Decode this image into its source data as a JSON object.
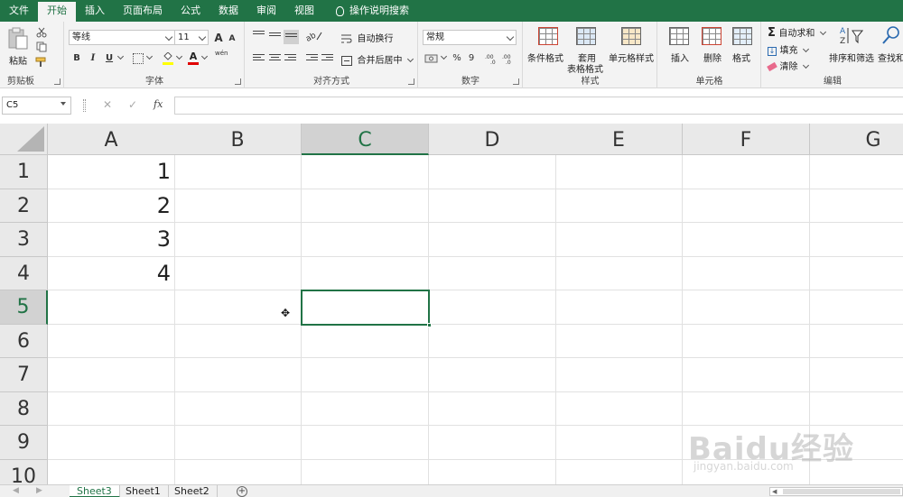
{
  "menu": {
    "tabs": [
      "文件",
      "开始",
      "插入",
      "页面布局",
      "公式",
      "数据",
      "审阅",
      "视图"
    ],
    "active_tab": "开始",
    "tell_me": "操作说明搜索"
  },
  "ribbon": {
    "clipboard": {
      "label": "剪贴板",
      "paste": "粘贴"
    },
    "font": {
      "label": "字体",
      "font_name": "等线",
      "font_size": "11",
      "grow": "A",
      "shrink": "A",
      "bold": "B",
      "italic": "I",
      "underline": "U",
      "wen": "wén"
    },
    "alignment": {
      "label": "对齐方式",
      "wrap": "自动换行",
      "merge": "合并后居中"
    },
    "number": {
      "label": "数字",
      "format": "常规",
      "percent": "%",
      "comma": "9"
    },
    "styles": {
      "label": "样式",
      "conditional": "条件格式",
      "table_line1": "套用",
      "table_line2": "表格格式",
      "cell_styles": "单元格样式"
    },
    "cells": {
      "label": "单元格",
      "insert": "插入",
      "delete": "删除",
      "format": "格式"
    },
    "editing": {
      "label": "编辑",
      "autosum": "自动求和",
      "fill": "填充",
      "clear": "清除",
      "sort": "排序和筛选",
      "find": "查找和"
    }
  },
  "formula_bar": {
    "name_box": "C5",
    "fx": "fx",
    "value": ""
  },
  "grid": {
    "columns": [
      "A",
      "B",
      "C",
      "D",
      "E",
      "F",
      "G"
    ],
    "selected_column": "C",
    "rows": [
      "1",
      "2",
      "3",
      "4",
      "5",
      "6",
      "7",
      "8",
      "9",
      "10"
    ],
    "selected_row": "5",
    "cells": {
      "A1": "1",
      "A2": "2",
      "A3": "3",
      "A4": "4"
    },
    "active_cell": "C5"
  },
  "sheets": {
    "tabs": [
      "Sheet3",
      "Sheet1",
      "Sheet2"
    ],
    "active": "Sheet3",
    "add": "+"
  },
  "watermark": {
    "logo": "Baidu经验",
    "url": "jingyan.baidu.com"
  },
  "colors": {
    "accent": "#217346"
  }
}
